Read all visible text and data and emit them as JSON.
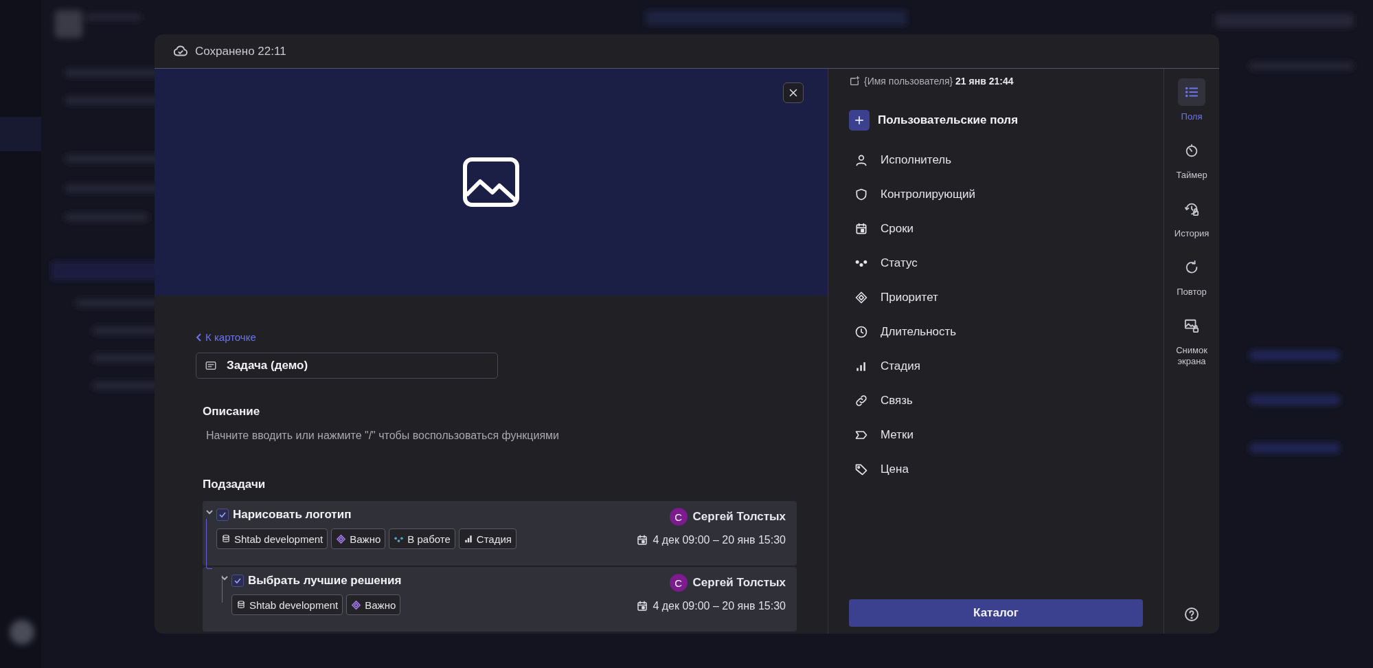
{
  "header": {
    "saved_status": "Сохранено 22:11"
  },
  "task": {
    "back_link": "К карточке",
    "title": "Задача (демо)",
    "description_label": "Описание",
    "description_placeholder": "Начните вводить или нажмите \"/\" чтобы воспользоваться функциями",
    "subtasks_label": "Подзадачи"
  },
  "subtasks": [
    {
      "title": "Нарисовать логотип",
      "checked": true,
      "expanded": true,
      "assignee": "Сергей Толстых",
      "avatar": "С",
      "dates": "4 дек 09:00 – 20 янв 15:30",
      "tags": [
        {
          "kind": "project",
          "label": "Shtab development"
        },
        {
          "kind": "priority",
          "label": "Важно"
        },
        {
          "kind": "status",
          "label": "В работе"
        },
        {
          "kind": "stage",
          "label": "Стадия"
        }
      ]
    },
    {
      "title": "Выбрать лучшие решения",
      "checked": true,
      "expanded": true,
      "assignee": "Сергей Толстых",
      "avatar": "С",
      "dates": "4 дек 09:00 – 20 янв 15:30",
      "tags": [
        {
          "kind": "project",
          "label": "Shtab development"
        },
        {
          "kind": "priority",
          "label": "Важно"
        }
      ]
    }
  ],
  "meta": {
    "author": "{Имя пользователя}",
    "created": "21 янв 21:44"
  },
  "custom_fields_button": "Пользовательские поля",
  "fields": [
    {
      "kind": "person",
      "label": "Исполнитель"
    },
    {
      "kind": "shield",
      "label": "Контролирующий"
    },
    {
      "kind": "calendar",
      "label": "Сроки"
    },
    {
      "kind": "dots",
      "label": "Статус"
    },
    {
      "kind": "diamond",
      "label": "Приоритет"
    },
    {
      "kind": "clock",
      "label": "Длительность"
    },
    {
      "kind": "bars",
      "label": "Стадия"
    },
    {
      "kind": "link",
      "label": "Связь"
    },
    {
      "kind": "tag",
      "label": "Метки"
    },
    {
      "kind": "price",
      "label": "Цена"
    }
  ],
  "catalog_button": "Каталог",
  "rail": [
    {
      "kind": "list",
      "label": "Поля",
      "selected": true
    },
    {
      "kind": "timer",
      "label": "Таймер",
      "selected": false
    },
    {
      "kind": "history",
      "label": "История",
      "selected": false
    },
    {
      "kind": "repeat",
      "label": "Повтор",
      "selected": false
    },
    {
      "kind": "screenshot",
      "label": "Снимок экрана",
      "selected": false
    }
  ]
}
